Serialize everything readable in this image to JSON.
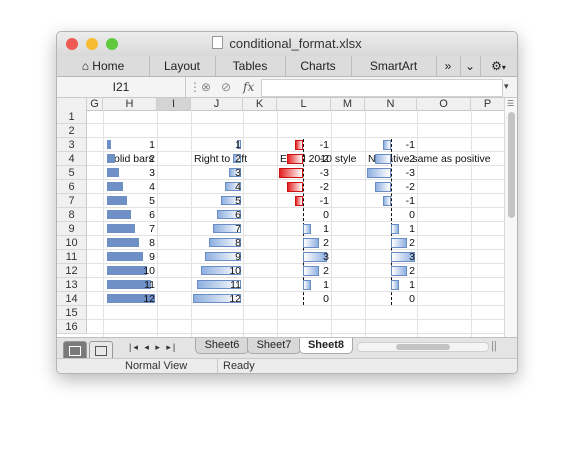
{
  "window": {
    "title": "conditional_format.xlsx"
  },
  "ribbon": {
    "tabs": [
      "Home",
      "Layout",
      "Tables",
      "Charts",
      "SmartArt"
    ],
    "more": "»"
  },
  "formula_bar": {
    "name_box": "I21",
    "fx": "fx"
  },
  "columns": [
    "G",
    "H",
    "I",
    "J",
    "K",
    "L",
    "M",
    "N",
    "O",
    "P"
  ],
  "rows": [
    "1",
    "2",
    "3",
    "4",
    "5",
    "6",
    "7",
    "8",
    "9",
    "10",
    "11",
    "12",
    "13",
    "14",
    "15",
    "16"
  ],
  "headers": {
    "solid": "Solid bars",
    "rtl": "Right to left",
    "excel2010": "Excel 2010 style",
    "negative": "Negative same as positive"
  },
  "solid_values": [
    1,
    2,
    3,
    4,
    5,
    6,
    7,
    8,
    9,
    10,
    11,
    12
  ],
  "rtl_values": [
    1,
    2,
    3,
    4,
    5,
    6,
    7,
    8,
    9,
    10,
    11,
    12
  ],
  "excel2010_values": [
    -1,
    -2,
    -3,
    -2,
    -1,
    0,
    1,
    2,
    3,
    2,
    1,
    0
  ],
  "negative_values": [
    -1,
    -2,
    -3,
    -2,
    -1,
    0,
    1,
    2,
    3,
    2,
    1,
    0
  ],
  "sheets": [
    "Sheet6",
    "Sheet7",
    "Sheet8"
  ],
  "active_sheet": "Sheet8",
  "status": {
    "view": "Normal View",
    "state": "Ready"
  },
  "colors": {
    "close": "#ee5b55",
    "minimize": "#f5bc2f",
    "zoom": "#5fca3e",
    "solid_bar": "#6f8fc7",
    "negative_bar": "#e52323"
  }
}
